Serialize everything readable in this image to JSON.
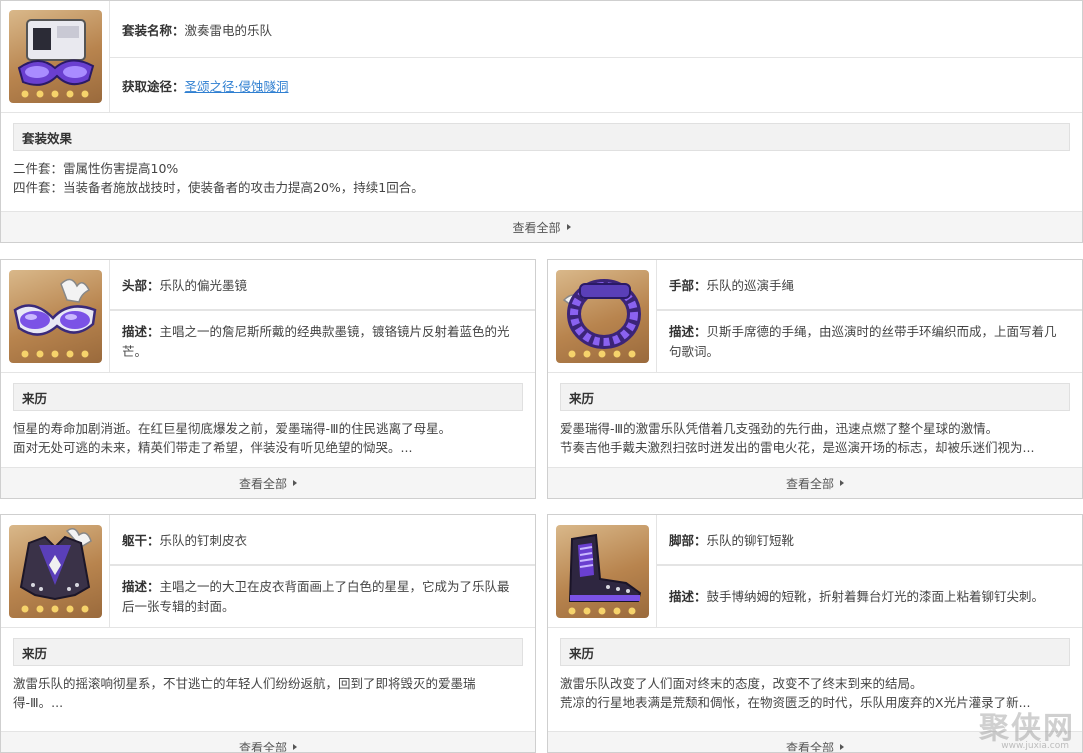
{
  "set": {
    "name_label": "套装名称：",
    "name_value": "激奏雷电的乐队",
    "source_label": "获取途径：",
    "source_link": "圣颂之径·侵蚀隧洞",
    "effects_title": "套装效果",
    "effects": [
      "二件套：雷属性伤害提高10%",
      "四件套：当装备者施放战技时，使装备者的攻击力提高20%，持续1回合。"
    ],
    "more_label": "查看全部"
  },
  "pieces": [
    {
      "slot_label": "头部：",
      "slot_value": "乐队的偏光墨镜",
      "desc_label": "描述：",
      "desc_value": "主唱之一的詹尼斯所戴的经典款墨镜，镀铬镜片反射着蓝色的光芒。",
      "story_title": "来历",
      "story": [
        "恒星的寿命加剧消逝。在红巨星彻底爆发之前，爱墨瑞得-Ⅲ的住民逃离了母星。",
        "面对无处可逃的未来，精英们带走了希望，伴装没有听见绝望的恸哭。..."
      ],
      "more_label": "查看全部",
      "icon": "sunglasses-icon"
    },
    {
      "slot_label": "手部：",
      "slot_value": "乐队的巡演手绳",
      "desc_label": "描述：",
      "desc_value": "贝斯手席德的手绳，由巡演时的丝带手环编织而成，上面写着几句歌词。",
      "story_title": "来历",
      "story": [
        "爱墨瑞得-Ⅲ的激雷乐队凭借着几支强劲的先行曲，迅速点燃了整个星球的激情。",
        "节奏吉他手戴夫激烈扫弦时迸发出的雷电火花，是巡演开场的标志，却被乐迷们视为..."
      ],
      "more_label": "查看全部",
      "icon": "wristband-icon"
    },
    {
      "slot_label": "躯干：",
      "slot_value": "乐队的钉刺皮衣",
      "desc_label": "描述：",
      "desc_value": "主唱之一的大卫在皮衣背面画上了白色的星星，它成为了乐队最后一张专辑的封面。",
      "story_title": "来历",
      "story": [
        "激雷乐队的摇滚响彻星系，不甘逃亡的年轻人们纷纷返航，回到了即将毁灭的爱墨瑞",
        "得-Ⅲ。..."
      ],
      "more_label": "查看全部",
      "icon": "leather-jacket-icon"
    },
    {
      "slot_label": "脚部：",
      "slot_value": "乐队的铆钉短靴",
      "desc_label": "描述：",
      "desc_value": "鼓手博纳姆的短靴，折射着舞台灯光的漆面上粘着铆钉尖刺。",
      "story_title": "来历",
      "story": [
        "激雷乐队改变了人们面对终末的态度，改变不了终末到来的结局。",
        "荒凉的行星地表满是荒颓和倜怅，在物资匮乏的时代，乐队用废弃的X光片灌录了新..."
      ],
      "more_label": "查看全部",
      "icon": "boots-icon"
    }
  ],
  "watermark": {
    "main": "聚侠网",
    "sub": "www.juxia.com"
  },
  "colors": {
    "link": "#2f7fd1",
    "thumb_bg": "#b8844e",
    "item_purple": "#6a3fd0",
    "star": "#f6d36b"
  }
}
